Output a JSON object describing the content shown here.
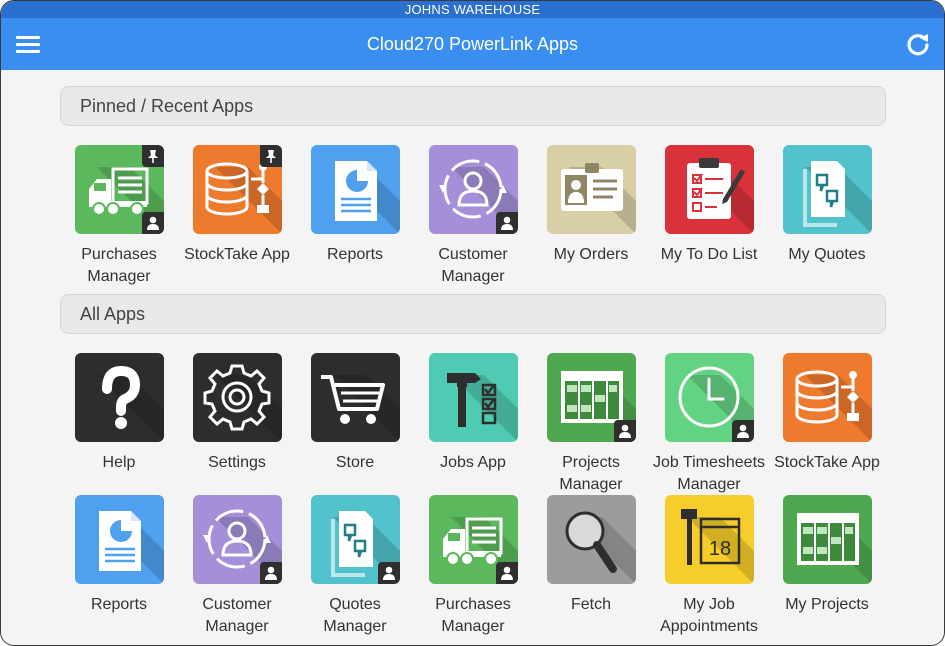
{
  "statusbar": {
    "title": "JOHNS WAREHOUSE"
  },
  "navbar": {
    "title": "Cloud270 PowerLink Apps"
  },
  "colors": {
    "navbar": "#3a8ef0",
    "statusbar": "#2b6fd1",
    "accent": "#3a8ef0"
  },
  "sections": {
    "pinned": {
      "title": "Pinned / Recent Apps"
    },
    "all": {
      "title": "All Apps"
    }
  },
  "pinned_apps": [
    {
      "label": "Purchases\nManager",
      "icon": "truck-icon",
      "color": "#5cb85c"
    },
    {
      "label": "StockTake App",
      "icon": "database-icon",
      "color": "#ee7a2e"
    },
    {
      "label": "Reports",
      "icon": "report-icon",
      "color": "#4fa0ee"
    },
    {
      "label": "Customer\nManager",
      "icon": "customer-icon",
      "color": "#a58fd8"
    },
    {
      "label": "My Orders",
      "icon": "id-card-icon",
      "color": "#d9cfa6"
    },
    {
      "label": "My To Do List",
      "icon": "clipboard-icon",
      "color": "#d9323a"
    },
    {
      "label": "My Quotes",
      "icon": "quote-doc-icon",
      "color": "#52c2cc"
    }
  ],
  "all_apps_row1": [
    {
      "label": "Help",
      "icon": "question-icon",
      "color": "#2d2d2d"
    },
    {
      "label": "Settings",
      "icon": "gear-icon",
      "color": "#2d2d2d"
    },
    {
      "label": "Store",
      "icon": "cart-icon",
      "color": "#2d2d2d"
    },
    {
      "label": "Jobs App",
      "icon": "hammer-icon",
      "color": "#4ecbb2"
    },
    {
      "label": "Projects\nManager",
      "icon": "board-icon",
      "color": "#4fa84f"
    },
    {
      "label": "Job Timesheets\nManager",
      "icon": "clock-icon",
      "color": "#64d283"
    },
    {
      "label": "StockTake App",
      "icon": "database-icon",
      "color": "#ee7a2e"
    }
  ],
  "all_apps_row2": [
    {
      "label": "Reports",
      "icon": "report-icon",
      "color": "#4fa0ee"
    },
    {
      "label": "Customer\nManager",
      "icon": "customer-icon",
      "color": "#a58fd8"
    },
    {
      "label": "Quotes\nManager",
      "icon": "quote-doc-icon",
      "color": "#52c2cc"
    },
    {
      "label": "Purchases\nManager",
      "icon": "truck-icon",
      "color": "#5cb85c"
    },
    {
      "label": "Fetch",
      "icon": "magnifier-icon",
      "color": "#9c9c9c"
    },
    {
      "label": "My Job\nAppointments",
      "icon": "calendar-icon",
      "color": "#f6cd2a"
    },
    {
      "label": "My Projects",
      "icon": "board-icon",
      "color": "#4fa84f"
    }
  ]
}
